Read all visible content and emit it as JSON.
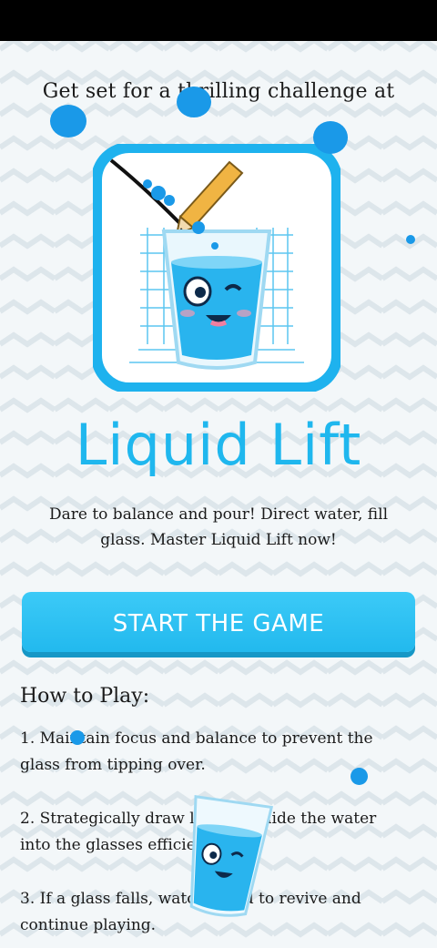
{
  "intro_text": "Get set for a thrilling challenge at",
  "app_title": "Liquid Lift",
  "tagline": "Dare to balance and pour! Direct water, fill glass. Master Liquid Lift now!",
  "start_button_label": "START THE GAME",
  "how_to_play": {
    "title": "How to Play:",
    "steps": [
      "1. Maintain focus and balance to prevent the glass from tipping over.",
      "2. Strategically draw lines to guide the water into the glasses efficiently.",
      "3. If a glass falls, watch an ad to revive and continue playing."
    ]
  },
  "colors": {
    "accent": "#1fb7ee",
    "button": "#22b9ee",
    "water_drop": "#1a99e8"
  },
  "icons": [
    "glass-mascot-icon",
    "pencil-icon",
    "water-drop-icon"
  ]
}
